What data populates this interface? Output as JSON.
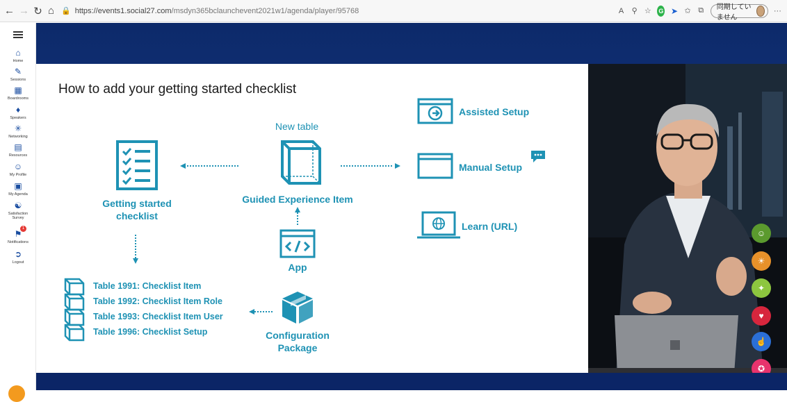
{
  "browser": {
    "url_scheme": "https://",
    "url_host": "events1.social27.com",
    "url_path": "/msdyn365bclaunchevent2021w1/agenda/player/95768",
    "sync_label": "同期していません"
  },
  "leftnav": {
    "items": [
      {
        "label": "Home",
        "icon": "home-icon"
      },
      {
        "label": "Sessions",
        "icon": "pencil-icon"
      },
      {
        "label": "Boardrooms",
        "icon": "boardroom-icon"
      },
      {
        "label": "Speakers",
        "icon": "speaker-icon"
      },
      {
        "label": "Networking",
        "icon": "networking-icon"
      },
      {
        "label": "Resources",
        "icon": "resources-icon"
      },
      {
        "label": "My Profile",
        "icon": "profile-icon"
      },
      {
        "label": "My Agenda",
        "icon": "agenda-icon"
      },
      {
        "label": "Satisfaction Survey",
        "icon": "survey-icon"
      },
      {
        "label": "Notifications",
        "icon": "bell-icon",
        "badge": "1"
      },
      {
        "label": "Logout",
        "icon": "logout-icon"
      }
    ]
  },
  "slide": {
    "title": "How to add your getting started checklist",
    "new_table": "New table",
    "guided_item": "Guided Experience Item",
    "getting_started_line1": "Getting started",
    "getting_started_line2": "checklist",
    "app": "App",
    "config_line1": "Configuration",
    "config_line2": "Package",
    "assisted_setup": "Assisted Setup",
    "manual_setup": "Manual Setup",
    "learn_url": "Learn (URL)",
    "tables": [
      "Table 1991: Checklist Item",
      "Table 1992: Checklist Item Role",
      "Table 1993: Checklist Item User",
      "Table 1996: Checklist Setup"
    ]
  },
  "reactions": [
    {
      "icon": "smile-icon",
      "color": "#5b9a2e"
    },
    {
      "icon": "lightbulb-icon",
      "color": "#e8912a"
    },
    {
      "icon": "party-icon",
      "color": "#8dc63f"
    },
    {
      "icon": "heart-icon",
      "color": "#d7263d"
    },
    {
      "icon": "thumbs-up-icon",
      "color": "#2b6fd6"
    },
    {
      "icon": "clap-icon",
      "color": "#e8336d"
    }
  ],
  "colors": {
    "accent": "#1e92b4",
    "navy": "#0e2c6e"
  }
}
